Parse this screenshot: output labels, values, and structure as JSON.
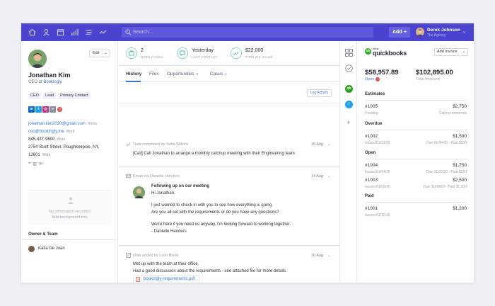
{
  "topbar": {
    "search_placeholder": "Search...",
    "add_label": "Add",
    "add_icon": "+",
    "user_name": "Derek Johnson",
    "user_org": "The Agency",
    "chevron": "⌄"
  },
  "contact": {
    "edit_label": "Edit",
    "edit_chevron": "⌄",
    "name": "Jonathan Kim",
    "title_prefix": "CEO at",
    "company": "Bookingly",
    "tags": [
      "CEO",
      "Lead",
      "Primary Contact"
    ],
    "social_badge": "3",
    "email_primary": "jonathan.kim2020@gmail.com",
    "email_primary_kind": "Home",
    "email_work": "ceo@bookingly.me",
    "email_work_kind": "Work",
    "phone": "845-437-9600",
    "phone_kind": "Work",
    "address_line1": "2754 Scott Street, Poughkeepsie, NY,",
    "address_line2": "12601",
    "address_kind": "Work",
    "background_line1": "No information recorded",
    "background_line2": "Add background info",
    "owner_section_title": "Owner & Team",
    "owner_name": "Katia De Juan"
  },
  "stats": [
    {
      "value": "2",
      "label": "OPEN CASES"
    },
    {
      "value": "Yesterday",
      "label": "LAST CONTACT"
    },
    {
      "value": "$22,000",
      "label": "PIPELINE VALUE"
    }
  ],
  "tabs": {
    "history": "History",
    "files": "Files",
    "opportunities": "Opportunities",
    "opportunities_count": "2",
    "cases": "Cases",
    "cases_count": "1"
  },
  "log_activity_label": "Log Activity",
  "feed": {
    "task_header": "Task completed by Sofia Wilkins",
    "task_date": "15 Aug",
    "task_text": "[Call] Call Jonathan to arrange a monthly catchup meeting with their Engineering team",
    "email_header": "Email via Danielle Henders",
    "email_date": "14 Aug",
    "email_subject": "Following up on our meeting",
    "email_greeting": "Hi Jonathan,",
    "email_line1": "I just wanted to check in with you to see how everything is going.",
    "email_line2": "Are you all set with the requirements or do you have any questions?",
    "email_line3": "We're here if you need us anyway. I'm looking forward to working together.",
    "email_signoff": "- Danielle Henders",
    "note_header": "Note added by Liam Blake",
    "note_date": "10 Aug",
    "note_line1": "Met up with the team at their office.",
    "note_line2": "Had a good discussion about the requirements - see attached file for more details.",
    "note_file": "bookingly-requirements.pdf",
    "chevron": "⌄"
  },
  "rail": {
    "qb_label": "qb",
    "twitter_label": "t",
    "plus": "+"
  },
  "quickbooks": {
    "intuit": "intuit",
    "brand": "quickbooks",
    "add_invoice_label": "Add Invoice",
    "add_invoice_chevron": "⌄",
    "open_amount": "$58,957.89",
    "open_label": "Open",
    "open_alert": "!",
    "total_amount": "$102,895.00",
    "total_label": "Total Invoiced",
    "estimates_title": "Estimates",
    "estimate_number": "#1005",
    "estimate_amount": "$2,750",
    "estimate_status": "Pending",
    "estimate_expires": "Expires tomorrow",
    "overdue_title": "Overdue",
    "overdue_number": "#1002",
    "overdue_amount": "$1,500",
    "overdue_issued": "Issued 01/01/20",
    "overdue_due": "Due 01/04/20 - Paid $500",
    "open_title": "Open",
    "open1_number": "#1004",
    "open1_amount": "$1,750",
    "open1_issued": "Issued 01/04/20",
    "open1_due": "Due 01/07/20 - Paid $250",
    "open2_number": "#1003",
    "open2_amount": "$2,500",
    "open2_issued": "Issued 01/05/20",
    "open2_due": "Due 01/08/20 - Paid $1,500",
    "paid_title": "Paid",
    "paid_number": "#1001",
    "paid_amount": "$1,200",
    "paid_issued": "Issued 01/10/19"
  },
  "colors": {
    "topbar": "#4a44d0",
    "accent": "#3b76d6",
    "teal": "#4bbfae",
    "quickbooks_green": "#2ca01c",
    "alert_red": "#e04b4b"
  }
}
